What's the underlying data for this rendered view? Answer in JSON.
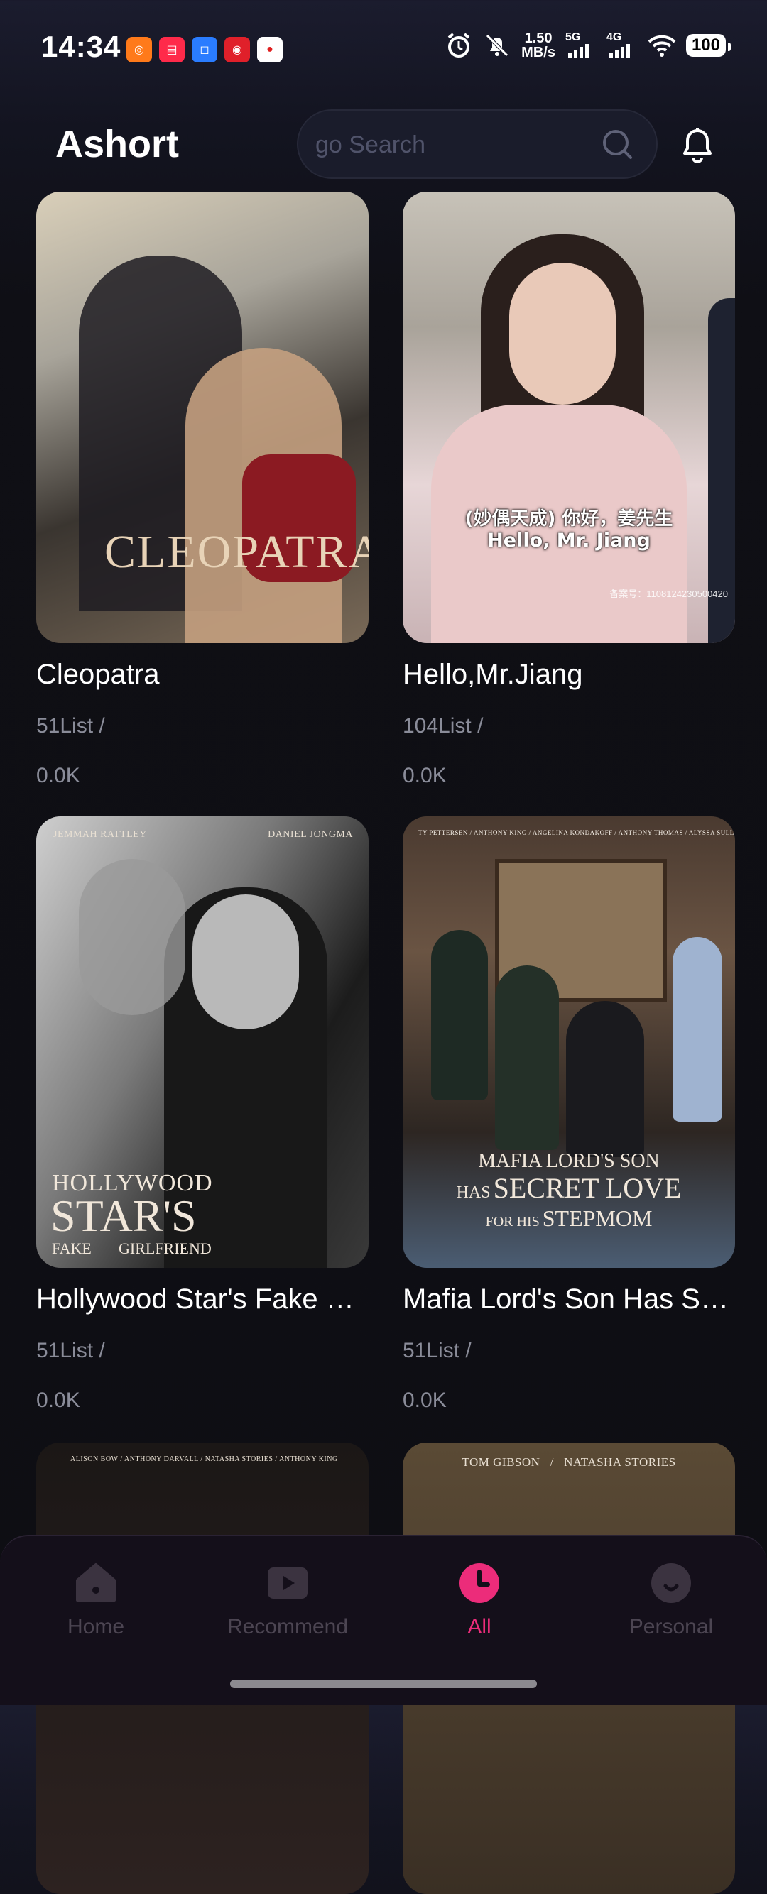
{
  "status": {
    "time": "14:34",
    "notif_icons": [
      "app-icon-1",
      "app-icon-2",
      "app-icon-3",
      "app-icon-4",
      "maps-icon"
    ],
    "speed_value": "1.50",
    "speed_unit": "MB/s",
    "net1": "5G",
    "net2": "4G",
    "battery": "100"
  },
  "header": {
    "title": "Ashort",
    "search_placeholder": "go Search"
  },
  "cards": [
    {
      "title": "Cleopatra",
      "episodes": "51List /",
      "views": "0.0K",
      "poster_text": "CLEOPATRA"
    },
    {
      "title": "Hello,Mr.Jiang",
      "episodes": "104List /",
      "views": "0.0K",
      "poster_subtitle_cn": "(妙偶天成) 你好，姜先生",
      "poster_subtitle_en": "Hello, Mr. Jiang",
      "poster_code": "备案号：1108124230500420"
    },
    {
      "title": "Hollywood Star's Fake …",
      "episodes": "51List /",
      "views": "0.0K",
      "cast_left": "JEMMAH RATTLEY",
      "cast_right": "DANIEL JONGMA",
      "poster_line1": "HOLLYWOOD",
      "poster_line2": "STAR'S",
      "poster_line3a": "FAKE",
      "poster_line3b": "GIRLFRIEND"
    },
    {
      "title": "Mafia Lord's Son Has S…",
      "episodes": "51List /",
      "views": "0.0K",
      "cast": "TY PETTERSEN / ANTHONY KING / ANGELINA KONDAKOFF / ANTHONY THOMAS / ALYSSA SULLIVAN",
      "poster_line1": "MAFIA LORD'S SON",
      "poster_line2a": "HAS",
      "poster_line2b": "SECRET LOVE",
      "poster_line3a": "FOR HIS",
      "poster_line3b": "STEPMOM"
    },
    {
      "cast": "ALISON BOW / ANTHONY DARVALL / NATASHA STORIES / ANTHONY KING"
    },
    {
      "cast": "TOM GIBSON   /   NATASHA STORIES"
    }
  ],
  "nav": [
    {
      "label": "Home",
      "icon": "home-icon"
    },
    {
      "label": "Recommend",
      "icon": "play-icon"
    },
    {
      "label": "All",
      "icon": "clock-icon"
    },
    {
      "label": "Personal",
      "icon": "person-icon"
    }
  ],
  "colors": {
    "accent": "#ec2c7a",
    "inactive": "#4c4552",
    "background": "#0e0e13"
  }
}
